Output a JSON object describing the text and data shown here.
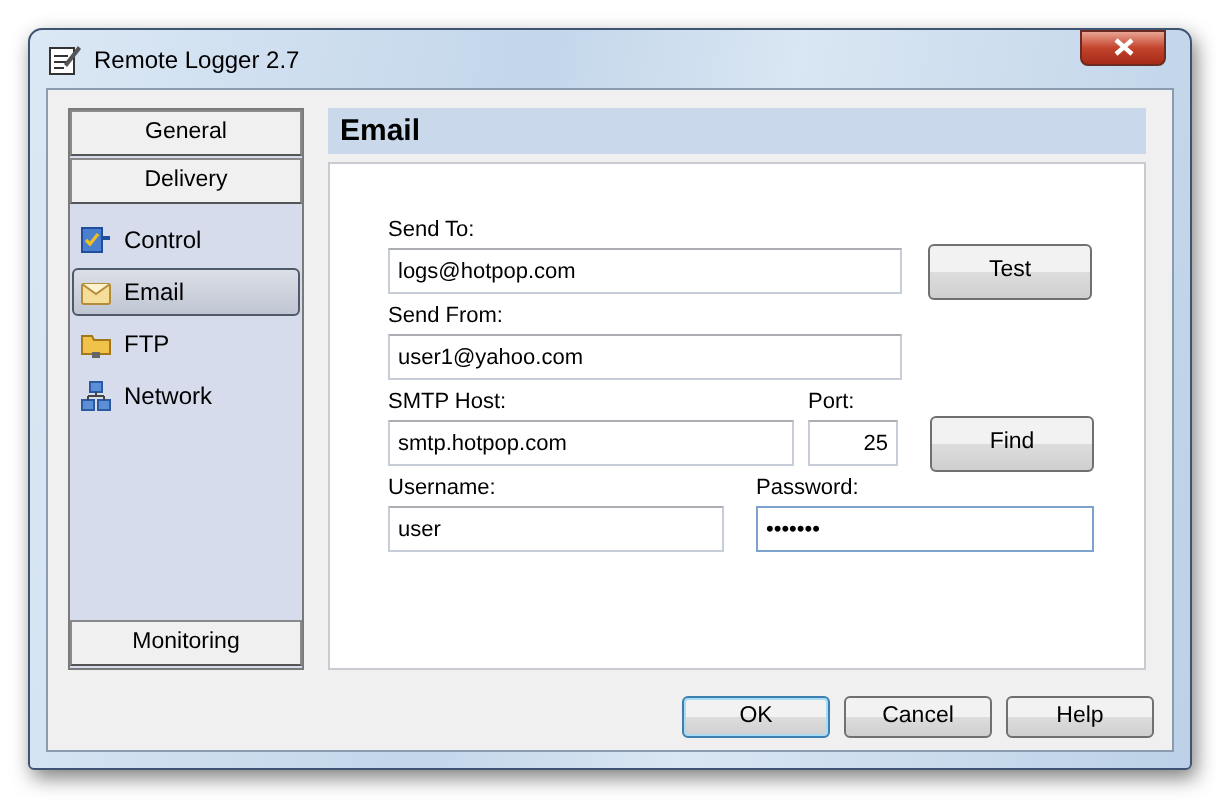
{
  "window": {
    "title": "Remote Logger 2.7"
  },
  "sidebar": {
    "groups_top": [
      {
        "label": "General"
      },
      {
        "label": "Delivery"
      }
    ],
    "items": [
      {
        "label": "Control",
        "selected": false
      },
      {
        "label": "Email",
        "selected": true
      },
      {
        "label": "FTP",
        "selected": false
      },
      {
        "label": "Network",
        "selected": false
      }
    ],
    "groups_bottom": [
      {
        "label": "Monitoring"
      }
    ]
  },
  "panel": {
    "title": "Email",
    "send_to": {
      "label": "Send To:",
      "value": "logs@hotpop.com"
    },
    "test_button": "Test",
    "send_from": {
      "label": "Send From:",
      "value": "user1@yahoo.com"
    },
    "smtp_host": {
      "label": "SMTP Host:",
      "value": "smtp.hotpop.com"
    },
    "port": {
      "label": "Port:",
      "value": "25"
    },
    "find_button": "Find",
    "username": {
      "label": "Username:",
      "value": "user"
    },
    "password": {
      "label": "Password:",
      "value": "•••••••",
      "focused": true
    }
  },
  "buttons": [
    {
      "label": "OK",
      "default": true
    },
    {
      "label": "Cancel",
      "default": false
    },
    {
      "label": "Help",
      "default": false
    }
  ]
}
